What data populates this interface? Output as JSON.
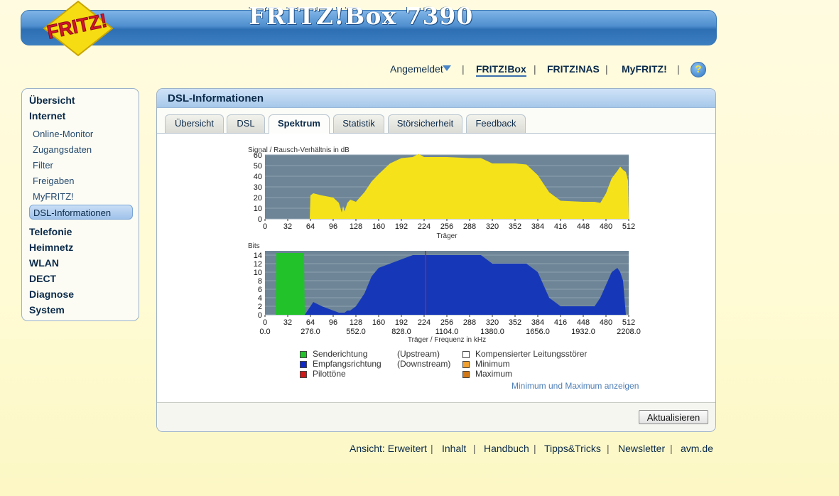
{
  "header": {
    "logo_text": "FRITZ!",
    "product_title": "FRITZ!Box 7390"
  },
  "topnav": {
    "login_status": "Angemeldet",
    "links": [
      "FRITZ!Box",
      "FRITZ!NAS",
      "MyFRITZ!"
    ],
    "separator": "|",
    "help": "?"
  },
  "sidebar": {
    "items": [
      {
        "label": "Übersicht"
      },
      {
        "label": "Internet"
      },
      {
        "label": "Online-Monitor"
      },
      {
        "label": "Zugangsdaten"
      },
      {
        "label": "Filter"
      },
      {
        "label": "Freigaben"
      },
      {
        "label": "MyFRITZ!"
      },
      {
        "label": "DSL-Informationen",
        "active": true
      },
      {
        "label": "Telefonie"
      },
      {
        "label": "Heimnetz"
      },
      {
        "label": "WLAN"
      },
      {
        "label": "DECT"
      },
      {
        "label": "Diagnose"
      },
      {
        "label": "System"
      }
    ]
  },
  "main": {
    "title": "DSL-Informationen",
    "tabs": [
      {
        "label": "Übersicht"
      },
      {
        "label": "DSL"
      },
      {
        "label": "Spektrum",
        "selected": true
      },
      {
        "label": "Statistik"
      },
      {
        "label": "Störsicherheit"
      },
      {
        "label": "Feedback"
      }
    ],
    "refresh_button": "Aktualisieren",
    "legend": {
      "upstream": "Senderichtung",
      "upstream_note": "(Upstream)",
      "downstream": "Empfangsrichtung",
      "downstream_note": "(Downstream)",
      "pilot": "Pilottöne",
      "compensated": "Kompensierter Leitungsstörer",
      "minimum": "Minimum",
      "maximum": "Maximum",
      "colors": {
        "upstream": "#22c22a",
        "downstream": "#1028c8",
        "pilot": "#d01818",
        "compensated": "#ffffff",
        "minimum": "#f0a030",
        "maximum": "#d07818"
      }
    },
    "minmax_link": "Minimum und Maximum anzeigen"
  },
  "chart_data": [
    {
      "type": "area",
      "ylabel": "Signal / Rausch-Verhältnis in dB",
      "xlabel": "Träger",
      "xlim": [
        0,
        512
      ],
      "ylim": [
        0,
        60
      ],
      "x_ticks": [
        0,
        32,
        64,
        96,
        128,
        160,
        192,
        224,
        256,
        288,
        320,
        352,
        384,
        416,
        448,
        480,
        512
      ],
      "y_ticks": [
        0,
        10,
        20,
        30,
        40,
        50,
        60
      ],
      "grid": true,
      "background": "#6d8597",
      "series": [
        {
          "color": "#f5e21a",
          "x": [
            0,
            63,
            64,
            68,
            80,
            96,
            104,
            108,
            110,
            112,
            116,
            120,
            128,
            140,
            150,
            160,
            176,
            192,
            208,
            216,
            224,
            240,
            256,
            288,
            304,
            320,
            336,
            352,
            368,
            384,
            400,
            416,
            448,
            464,
            472,
            480,
            488,
            496,
            500,
            504,
            508,
            511,
            512
          ],
          "y": [
            0,
            0,
            22,
            24,
            22,
            20,
            15,
            6,
            12,
            7,
            15,
            18,
            16,
            25,
            35,
            42,
            52,
            57,
            58,
            61,
            58,
            58,
            58,
            57,
            57,
            52,
            52,
            52,
            51,
            41,
            25,
            17,
            16,
            16,
            15,
            24,
            38,
            45,
            49,
            46,
            44,
            36,
            0
          ]
        }
      ]
    },
    {
      "type": "area",
      "ylabel": "Bits",
      "xlabel": "Träger / Frequenz in kHz",
      "xlim": [
        0,
        512
      ],
      "ylim": [
        0,
        15
      ],
      "x_ticks": [
        0,
        32,
        64,
        96,
        128,
        160,
        192,
        224,
        256,
        288,
        320,
        352,
        384,
        416,
        448,
        480,
        512
      ],
      "x_ticks_khz": [
        "0.0",
        "276.0",
        "552.0",
        "828.0",
        "1104.0",
        "1380.0",
        "1656.0",
        "1932.0",
        "2208.0"
      ],
      "y_ticks": [
        0,
        2,
        4,
        6,
        8,
        10,
        12,
        14
      ],
      "grid": true,
      "background": "#6d8597",
      "series": [
        {
          "name": "Senderichtung",
          "color": "#22c22a",
          "x": [
            15,
            16,
            32,
            50,
            54,
            55,
            56
          ],
          "y": [
            0,
            14.5,
            14.5,
            14.5,
            14.5,
            14,
            0
          ]
        },
        {
          "name": "Empfangsrichtung",
          "color": "#1638b8",
          "x": [
            56,
            64,
            68,
            80,
            96,
            104,
            108,
            112,
            116,
            120,
            128,
            140,
            150,
            160,
            176,
            192,
            208,
            224,
            240,
            256,
            288,
            304,
            320,
            336,
            352,
            368,
            384,
            400,
            416,
            448,
            464,
            472,
            480,
            488,
            496,
            500,
            504,
            508,
            512
          ],
          "y": [
            0,
            2,
            3,
            2,
            1,
            0.5,
            0.5,
            0.5,
            1,
            1,
            2,
            5,
            9,
            11,
            12,
            13,
            14,
            14,
            14,
            14,
            14,
            14,
            12,
            12,
            12,
            12,
            10,
            4,
            2,
            2,
            2,
            4,
            7,
            10,
            11,
            10,
            8,
            0,
            0
          ]
        },
        {
          "name": "Pilottöne",
          "color": "#d01818",
          "x": [
            226
          ],
          "y": [
            15
          ]
        }
      ]
    }
  ],
  "footer": {
    "links": [
      "Ansicht: Erweitert",
      "Inhalt",
      "Handbuch",
      "Tipps&Tricks",
      "Newsletter",
      "avm.de"
    ]
  }
}
